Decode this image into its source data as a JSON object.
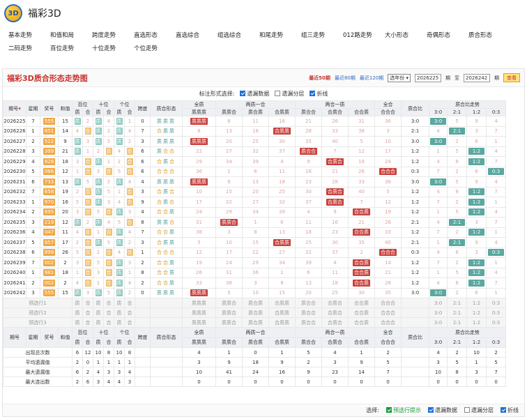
{
  "app": {
    "title": "福彩3D",
    "logo": "3D"
  },
  "nav": [
    "基本走势",
    "和值和局",
    "跨度走势",
    "直选形态",
    "直选综合",
    "组选综合",
    "和尾走势",
    "组三走势",
    "012路走势",
    "大小形态",
    "奇偶形态",
    "质合形态",
    "二码走势",
    "百位走势",
    "十位走势",
    "个位走势"
  ],
  "panel": {
    "title": "福彩3D质合形态走势图",
    "range": [
      "最近50期",
      "最近80期",
      "最近120期"
    ],
    "year_select": "选年份",
    "from": "2026225",
    "to_label": "至",
    "to": "2026242",
    "qi": "期",
    "query": "查看"
  },
  "marks": {
    "label": "标注形式选择:",
    "opt1": "遗漏数据",
    "opt2": "遗漏分层",
    "opt3": "折线"
  },
  "head": {
    "c1": "期号",
    "c2": "星期",
    "c3": "奖号",
    "c4": "和值",
    "bai": "百位",
    "shi": "十位",
    "ge": "个位",
    "kd": "跨度",
    "xt": "质合形态",
    "qz": "全质",
    "lz": "两质一合",
    "lh": "两合一质",
    "qh": "全合",
    "zhb": "质合比",
    "zs": "质合比走势",
    "zh": "质",
    "hh": "合",
    "qzz": "质质质",
    "zzh": "质质合",
    "zhz": "质合质",
    "hzz": "合质质",
    "zhh": "质合合",
    "hzh": "合质合",
    "hhz": "合合质",
    "hhh": "合合合",
    "r31": "3:0",
    "r21": "2:1",
    "r12": "1:2",
    "r03": "0:3"
  },
  "rows": [
    [
      "2026225",
      "7",
      "555",
      "15",
      "555",
      "3:0",
      "q"
    ],
    [
      "2026226",
      "1",
      "851",
      "14",
      "851",
      "2:1",
      "a"
    ],
    [
      "2026227",
      "2",
      "522",
      "9",
      "522",
      "3:0",
      "q"
    ],
    [
      "2026228",
      "3",
      "399",
      "21",
      "399",
      "1:2",
      "b"
    ],
    [
      "2026229",
      "4",
      "828",
      "18",
      "828",
      "1:2",
      "b"
    ],
    [
      "2026230",
      "5",
      "066",
      "12",
      "066",
      "0:3",
      "h"
    ],
    [
      "2026231",
      "6",
      "733",
      "13",
      "733",
      "3:0",
      "q"
    ],
    [
      "2026232",
      "7",
      "658",
      "19",
      "658",
      "1:2",
      "b"
    ],
    [
      "2026233",
      "1",
      "970",
      "16",
      "970",
      "1:2",
      "b"
    ],
    [
      "2026234",
      "2",
      "695",
      "20",
      "695",
      "1:2",
      "b"
    ],
    [
      "2026235",
      "3",
      "219",
      "12",
      "219",
      "2:1",
      "a"
    ],
    [
      "2026236",
      "4",
      "047",
      "11",
      "047",
      "1:2",
      "b"
    ],
    [
      "2026237",
      "5",
      "857",
      "17",
      "857",
      "2:1",
      "a"
    ],
    [
      "2026238",
      "6",
      "899",
      "26",
      "899",
      "0:3",
      "h"
    ],
    [
      "2026239",
      "7",
      "002",
      "2",
      "002",
      "1:2",
      "b"
    ],
    [
      "2026240",
      "1",
      "981",
      "18",
      "981",
      "1:2",
      "b"
    ],
    [
      "2026241",
      "2",
      "002",
      "2",
      "002",
      "1:2",
      "b"
    ],
    [
      "2026242",
      "3",
      "555",
      "15",
      "555",
      "3:0",
      "q"
    ]
  ],
  "forecast": [
    "预选行1",
    "预选行2",
    "预选行3"
  ],
  "stats": [
    {
      "label": "出现总次数",
      "v": [
        "6",
        "12",
        "10",
        "8",
        "10",
        "8",
        "4",
        "1",
        "0",
        "1",
        "5",
        "4",
        "1",
        "2",
        "4",
        "2",
        "10",
        "2"
      ]
    },
    {
      "label": "平均遗漏值",
      "v": [
        "2",
        "0",
        "1",
        "1",
        "1",
        "1",
        "3",
        "9",
        "18",
        "9",
        "2",
        "3",
        "9",
        "5",
        "3",
        "5",
        "1",
        "5"
      ]
    },
    {
      "label": "最大遗漏值",
      "v": [
        "6",
        "2",
        "4",
        "3",
        "3",
        "4",
        "10",
        "41",
        "24",
        "16",
        "9",
        "23",
        "14",
        "7",
        "10",
        "8",
        "3",
        "7"
      ]
    },
    {
      "label": "最大连出数",
      "v": [
        "2",
        "6",
        "3",
        "4",
        "4",
        "3",
        "0",
        "0",
        "0",
        "0",
        "0",
        "0",
        "0",
        "0",
        "0",
        "0",
        "0",
        "0"
      ]
    }
  ],
  "footer": {
    "label": "选择:",
    "opt1": "预选行提示",
    "opt2": "遗漏数据",
    "opt3": "遗漏分层",
    "opt4": "折线"
  },
  "colors": {
    "accent": "#c8332e",
    "nav_link": "#2d6ac2"
  }
}
